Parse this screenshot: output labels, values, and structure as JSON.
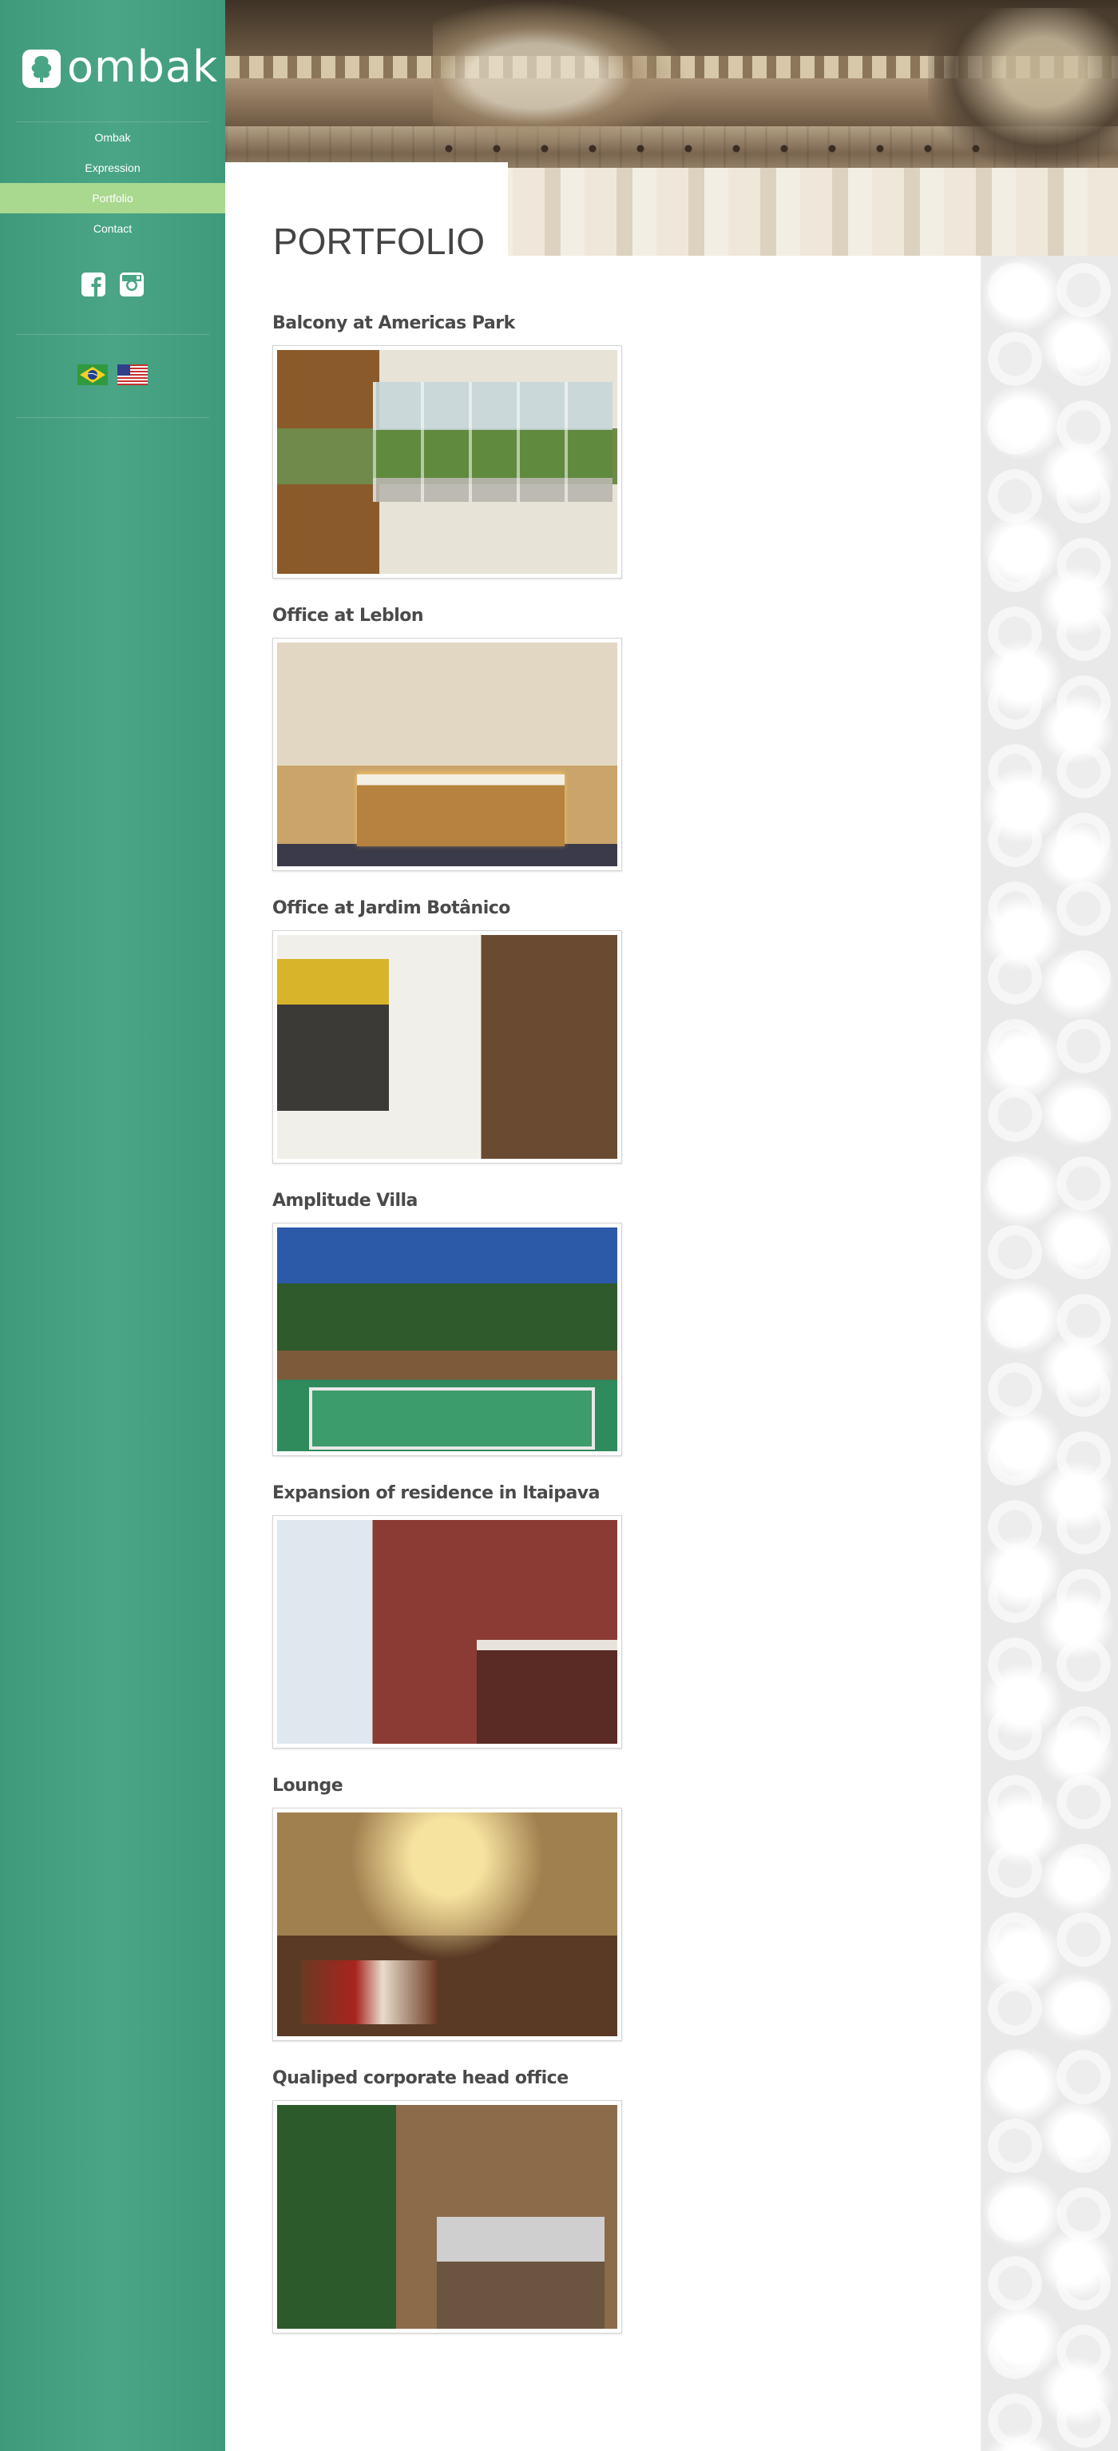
{
  "brand": {
    "name": "ombak",
    "colors": {
      "sidebar": "#4aa586",
      "active_nav": "#a9d88f",
      "title_text": "#444444"
    }
  },
  "nav": {
    "items": [
      {
        "label": "Ombak"
      },
      {
        "label": "Expression"
      },
      {
        "label": "Portfolio",
        "active": true
      },
      {
        "label": "Contact"
      }
    ]
  },
  "social": {
    "icons": [
      "facebook-icon",
      "instagram-icon"
    ]
  },
  "languages": {
    "flags": [
      "brazil-flag-icon",
      "usa-flag-icon"
    ]
  },
  "page": {
    "title": "PORTFOLIO"
  },
  "projects": [
    {
      "title": "Balcony at Americas Park"
    },
    {
      "title": "Office at Leblon"
    },
    {
      "title": "Office at Jardim Botânico"
    },
    {
      "title": "Amplitude Villa"
    },
    {
      "title": "Expansion of residence in Itaipava"
    },
    {
      "title": "Lounge"
    },
    {
      "title": "Qualiped corporate head office"
    }
  ]
}
